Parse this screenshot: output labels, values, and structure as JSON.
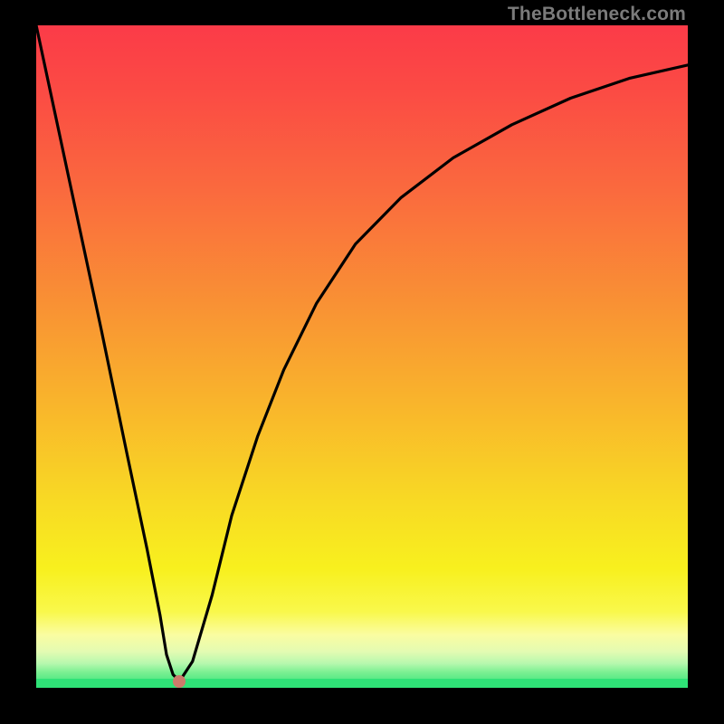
{
  "watermark": "TheBottleneck.com",
  "chart_data": {
    "type": "line",
    "title": "",
    "xlabel": "",
    "ylabel": "",
    "xlim": [
      0,
      100
    ],
    "ylim": [
      0,
      100
    ],
    "series": [
      {
        "name": "bottleneck-curve",
        "x": [
          0,
          5,
          10,
          14,
          17,
          19,
          20,
          21,
          22,
          24,
          27,
          30,
          34,
          38,
          43,
          49,
          56,
          64,
          73,
          82,
          91,
          100
        ],
        "values": [
          100,
          77,
          54,
          35,
          21,
          11,
          5,
          2,
          1,
          4,
          14,
          26,
          38,
          48,
          58,
          67,
          74,
          80,
          85,
          89,
          92,
          94
        ]
      }
    ],
    "marker": {
      "x": 22,
      "y": 1,
      "label": "optimal-point"
    },
    "gradient_bands": [
      {
        "name": "red",
        "approx_y": 100
      },
      {
        "name": "orange",
        "approx_y": 55
      },
      {
        "name": "yellow",
        "approx_y": 25
      },
      {
        "name": "pale",
        "approx_y": 8
      },
      {
        "name": "green",
        "approx_y": 0
      }
    ]
  }
}
